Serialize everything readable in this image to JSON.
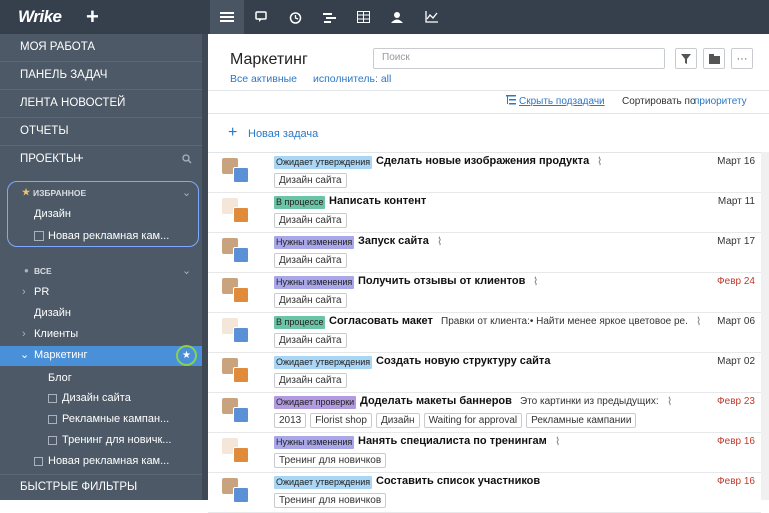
{
  "app": {
    "logo": "Wrike",
    "add_label": "+"
  },
  "sidebar": {
    "my_work": "МОЯ РАБОТА",
    "task_panel": "ПАНЕЛЬ ЗАДАЧ",
    "news": "ЛЕНТА НОВОСТЕЙ",
    "reports": "ОТЧЕТЫ",
    "projects": "ПРОЕКТЫ",
    "favorites": {
      "header": "ИЗБРАННОЕ",
      "items": [
        "Дизайн",
        "Новая рекламная кам..."
      ]
    },
    "all": {
      "header": "ВСЕ",
      "items": [
        "PR",
        "Дизайн",
        "Клиенты",
        "Маркетинг"
      ]
    },
    "marketing_children": [
      "Блог",
      "Дизайн сайта",
      "Рекламные кампан...",
      "Тренинг для новичк..."
    ],
    "after": "Новая рекламная кам...",
    "quick_filters": "БЫСТРЫЕ ФИЛЬТРЫ"
  },
  "main": {
    "title": "Маркетинг",
    "search_placeholder": "Поиск",
    "filter_all": "Все активные",
    "filter_assignee": "исполнитель: all",
    "hide_subtasks": "Скрыть подзадачи",
    "sort_label": "Сортировать по",
    "sort_value": "приоритету",
    "new_task": "Новая задача"
  },
  "colors": {
    "topbar": "#35404c",
    "sidebar": "#4d5966",
    "selected": "#4a90d9",
    "link": "#2b78c5",
    "waiting": "#a9d6f5",
    "progress": "#6bc4a6",
    "changes": "#a9a7e8",
    "review": "#b29ae0"
  },
  "tasks": [
    {
      "status": "Ожидает утверждения",
      "color": "#a9d6f5",
      "title": "Сделать новые изображения продукта",
      "desc": "",
      "clip": true,
      "date": "Март 16",
      "overdue": false,
      "tags": [
        "Дизайн сайта"
      ]
    },
    {
      "status": "В процессе",
      "color": "#6bc4a6",
      "title": "Написать контент",
      "desc": "",
      "clip": false,
      "date": "Март 11",
      "overdue": false,
      "tags": [
        "Дизайн сайта"
      ]
    },
    {
      "status": "Нужны изменения",
      "color": "#a9a7e8",
      "title": "Запуск сайта",
      "desc": "",
      "clip": true,
      "date": "Март 17",
      "overdue": false,
      "tags": [
        "Дизайн сайта"
      ]
    },
    {
      "status": "Нужны изменения",
      "color": "#a9a7e8",
      "title": "Получить отзывы от клиентов",
      "desc": "",
      "clip": true,
      "date": "Февр 24",
      "overdue": true,
      "tags": [
        "Дизайн сайта"
      ]
    },
    {
      "status": "В процессе",
      "color": "#6bc4a6",
      "title": "Согласовать макет",
      "desc": "Правки от клиента:• Найти менее яркое цветовое ре...",
      "clip": true,
      "date": "Март 06",
      "overdue": false,
      "tags": [
        "Дизайн сайта"
      ]
    },
    {
      "status": "Ожидает утверждения",
      "color": "#a9d6f5",
      "title": "Создать новую структуру сайта",
      "desc": "",
      "clip": false,
      "date": "Март 02",
      "overdue": false,
      "tags": [
        "Дизайн сайта"
      ]
    },
    {
      "status": "Ожидает проверки",
      "color": "#b29ae0",
      "title": "Доделать макеты баннеров",
      "desc": "Это картинки из предыдущих:",
      "clip": true,
      "date": "Февр 23",
      "overdue": true,
      "tags": [
        "2013",
        "Florist shop",
        "Дизайн",
        "Waiting for approval",
        "Рекламные кампании"
      ]
    },
    {
      "status": "Нужны изменения",
      "color": "#a9a7e8",
      "title": "Нанять специалиста по тренингам",
      "desc": "",
      "clip": true,
      "date": "Февр 16",
      "overdue": true,
      "tags": [
        "Тренинг для новичков"
      ]
    },
    {
      "status": "Ожидает утверждения",
      "color": "#a9d6f5",
      "title": "Составить список участников",
      "desc": "",
      "clip": false,
      "date": "Февр 16",
      "overdue": true,
      "tags": [
        "Тренинг для новичков"
      ]
    }
  ]
}
